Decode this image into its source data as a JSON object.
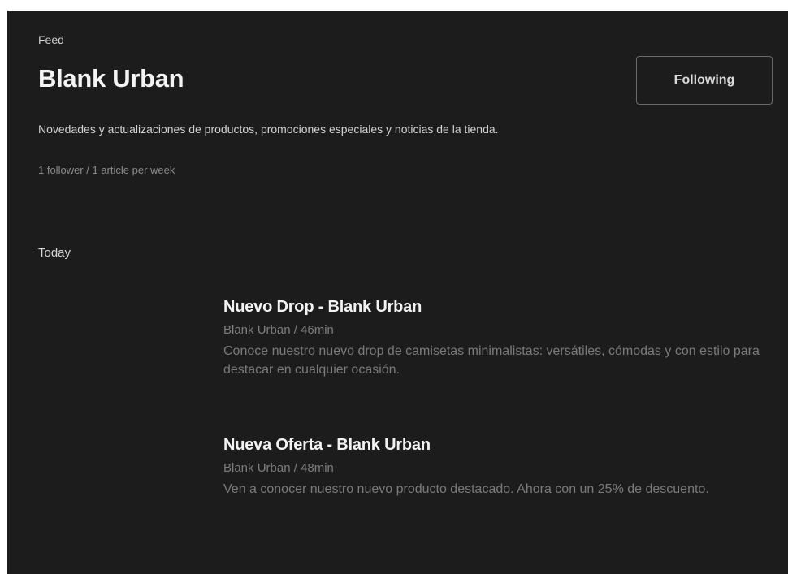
{
  "header": {
    "breadcrumb": "Feed",
    "title": "Blank Urban",
    "follow_label": "Following",
    "description": "Novedades y actualizaciones de productos, promociones especiales y noticias de la tienda.",
    "stats": "1 follower / 1 article per week"
  },
  "feed": {
    "section_label": "Today",
    "articles": [
      {
        "title": "Nuevo Drop - Blank Urban",
        "meta": "Blank Urban / 46min",
        "snippet": "Conoce nuestro nuevo drop de camisetas minimalistas: versátiles, cómodas y con estilo para destacar en cualquier ocasión."
      },
      {
        "title": "Nueva Oferta - Blank Urban",
        "meta": "Blank Urban / 48min",
        "snippet": "Ven a conocer nuestro nuevo producto destacado. Ahora con un 25% de descuento."
      }
    ]
  },
  "colors": {
    "background": "#1c1c1c",
    "title_text": "#f4f4f4",
    "muted_text": "#7d7d7d",
    "button_border": "#6a6a6a"
  }
}
